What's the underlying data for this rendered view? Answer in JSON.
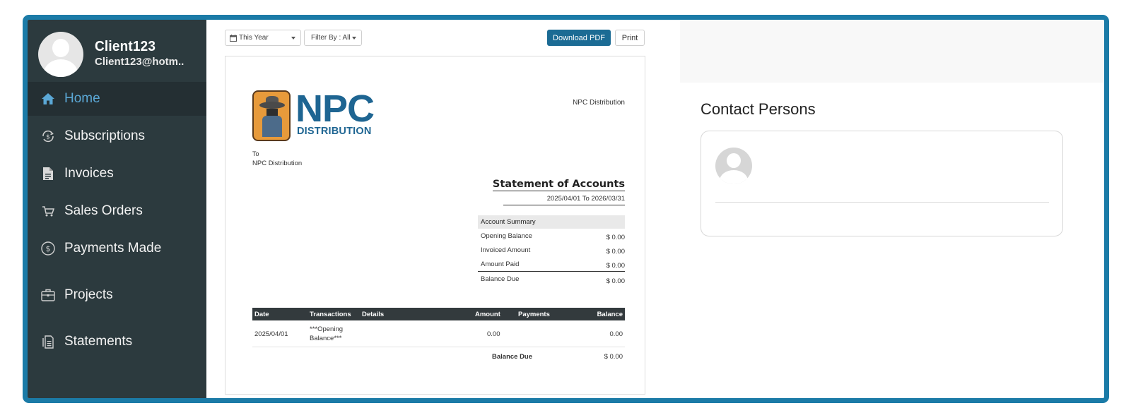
{
  "profile": {
    "name": "Client123",
    "email": "Client123@hotm.."
  },
  "nav": [
    {
      "label": "Home",
      "icon": "home-icon",
      "active": true
    },
    {
      "label": "Subscriptions",
      "icon": "subscriptions-icon",
      "active": false
    },
    {
      "label": "Invoices",
      "icon": "invoice-icon",
      "active": false
    },
    {
      "label": "Sales Orders",
      "icon": "cart-icon",
      "active": false
    },
    {
      "label": "Payments Made",
      "icon": "dollar-circle-icon",
      "active": false
    },
    {
      "label": "Projects",
      "icon": "briefcase-icon",
      "active": false
    },
    {
      "label": "Statements",
      "icon": "statements-icon",
      "active": false
    }
  ],
  "toolbar": {
    "period_value": "This Year",
    "filter_value": "Filter By : All",
    "download_label": "Download PDF",
    "print_label": "Print"
  },
  "statement": {
    "logo_main": "NPC",
    "logo_sub": "DISTRIBUTION",
    "org_name": "NPC Distribution",
    "to_label": "To",
    "to_name": "NPC Distribution",
    "title": "Statement of Accounts",
    "range": "2025/04/01 To 2026/03/31",
    "summary": {
      "header": "Account Summary",
      "rows": [
        {
          "label": "Opening Balance",
          "value": "$ 0.00"
        },
        {
          "label": "Invoiced Amount",
          "value": "$ 0.00"
        },
        {
          "label": "Amount Paid",
          "value": "$ 0.00"
        }
      ],
      "total": {
        "label": "Balance Due",
        "value": "$ 0.00"
      }
    },
    "table": {
      "columns": [
        "Date",
        "Transactions",
        "Details",
        "Amount",
        "Payments",
        "Balance"
      ],
      "rows": [
        {
          "date": "2025/04/01",
          "transaction_line1": "***Opening",
          "transaction_line2": "Balance***",
          "details": "",
          "amount": "0.00",
          "payments": "",
          "balance": "0.00"
        }
      ],
      "total_label": "Balance Due",
      "total_value": "$ 0.00"
    }
  },
  "contacts": {
    "title": "Contact Persons"
  },
  "colors": {
    "frame": "#1b7ba7",
    "sidebar": "#2c3a3e",
    "active_nav_text": "#5ba8d6",
    "primary_button": "#1b6b94",
    "logo_blue": "#1e6592"
  }
}
